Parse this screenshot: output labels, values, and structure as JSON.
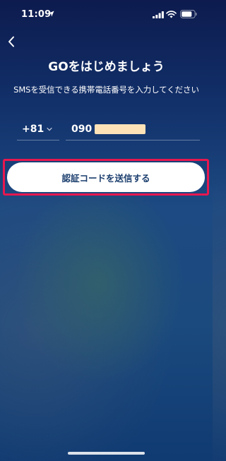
{
  "status_bar": {
    "time": "11:09",
    "icons": [
      "location-arrow-icon",
      "cellular-signal-icon",
      "wifi-icon",
      "battery-icon"
    ]
  },
  "header": {
    "back_icon": "chevron-left-icon",
    "title": "GOをはじめましょう"
  },
  "form": {
    "instruction": "SMSを受信できる携帯電話番号を入力してください",
    "country_code": "+81",
    "country_code_icon": "chevron-down-icon",
    "phone_prefix": "090",
    "phone_redacted": true
  },
  "actions": {
    "send_code_label": "認証コードを送信する"
  },
  "colors": {
    "button_bg": "#ffffff",
    "button_text": "#1a3d6d",
    "highlight": "#e8174f",
    "redaction": "#fde2b8"
  }
}
